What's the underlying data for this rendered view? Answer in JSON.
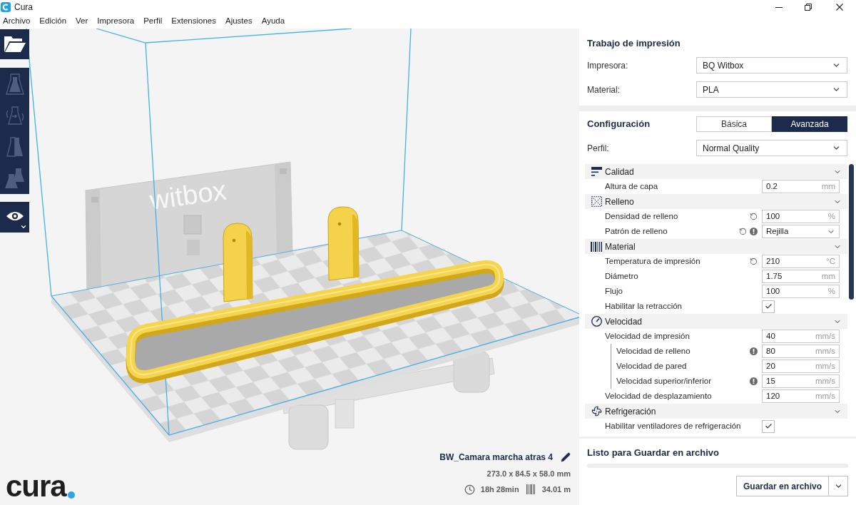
{
  "window": {
    "title": "Cura"
  },
  "menu": [
    "Archivo",
    "Edición",
    "Ver",
    "Impresora",
    "Perfil",
    "Extensiones",
    "Ajustes",
    "Ayuda"
  ],
  "toolbar": {
    "tools": [
      {
        "kind": "filled",
        "disabled": true
      },
      {
        "kind": "arrows",
        "disabled": true
      },
      {
        "kind": "halves",
        "disabled": true
      },
      {
        "kind": "pair",
        "disabled": true
      }
    ]
  },
  "viewport": {
    "panel_label": "witbox",
    "job": {
      "name": "BW_Camara marcha atras 4",
      "dimensions": "273.0 x 84.5 x 58.0 mm",
      "time": "18h 28min",
      "filament": "34.01 m"
    },
    "logo": "cura"
  },
  "print_job": {
    "title": "Trabajo de impresión",
    "fields": [
      {
        "label": "Impresora:",
        "value": "BQ Witbox"
      },
      {
        "label": "Material:",
        "value": "PLA"
      }
    ]
  },
  "configuration": {
    "title": "Configuración",
    "tabs": [
      {
        "label": "Básica",
        "selected": false
      },
      {
        "label": "Avanzada",
        "selected": true
      }
    ],
    "profile": {
      "label": "Perfil:",
      "value": "Normal Quality"
    },
    "categories": [
      {
        "kind": "quality",
        "label": "Calidad",
        "expanded": true,
        "settings": [
          {
            "kind": "number",
            "label": "Altura de capa",
            "value": "0.2",
            "unit": "mm",
            "reset": false,
            "warning": false
          }
        ]
      },
      {
        "kind": "infill",
        "label": "Relleno",
        "expanded": true,
        "settings": [
          {
            "kind": "number",
            "label": "Densidad de relleno",
            "value": "100",
            "unit": "%",
            "reset": true,
            "warning": false
          },
          {
            "kind": "select",
            "label": "Patrón de relleno",
            "value": "Rejilla",
            "reset": true,
            "warning": true
          }
        ]
      },
      {
        "kind": "material",
        "label": "Material",
        "expanded": true,
        "settings": [
          {
            "kind": "number",
            "label": "Temperatura de impresión",
            "value": "210",
            "unit": "°C",
            "reset": true,
            "warning": false
          },
          {
            "kind": "number",
            "label": "Diámetro",
            "value": "1.75",
            "unit": "mm",
            "reset": false,
            "warning": false
          },
          {
            "kind": "number",
            "label": "Flujo",
            "value": "100",
            "unit": "%",
            "reset": false,
            "warning": false
          },
          {
            "kind": "checkbox",
            "label": "Habilitar la retracción",
            "checked": true,
            "reset": false,
            "warning": false
          }
        ]
      },
      {
        "kind": "speed",
        "label": "Velocidad",
        "expanded": true,
        "settings": [
          {
            "kind": "number",
            "label": "Velocidad de impresión",
            "value": "40",
            "unit": "mm/s",
            "reset": false,
            "warning": false,
            "children": [
              {
                "kind": "number",
                "label": "Velocidad de relleno",
                "value": "80",
                "unit": "mm/s",
                "reset": false,
                "warning": true
              },
              {
                "kind": "number",
                "label": "Velocidad de pared",
                "value": "20",
                "unit": "mm/s",
                "reset": false,
                "warning": false
              },
              {
                "kind": "number",
                "label": "Velocidad superior/inferior",
                "value": "15",
                "unit": "mm/s",
                "reset": false,
                "warning": true
              }
            ]
          },
          {
            "kind": "number",
            "label": "Velocidad de desplazamiento",
            "value": "120",
            "unit": "mm/s",
            "reset": false,
            "warning": false
          }
        ]
      },
      {
        "kind": "cooling",
        "label": "Refrigeración",
        "expanded": true,
        "settings": [
          {
            "kind": "checkbox",
            "label": "Habilitar ventiladores de refrigeración",
            "checked": true,
            "reset": false,
            "warning": false
          }
        ]
      }
    ]
  },
  "output": {
    "status": "Listo para Guardar en archivo",
    "button": "Guardar en archivo"
  }
}
